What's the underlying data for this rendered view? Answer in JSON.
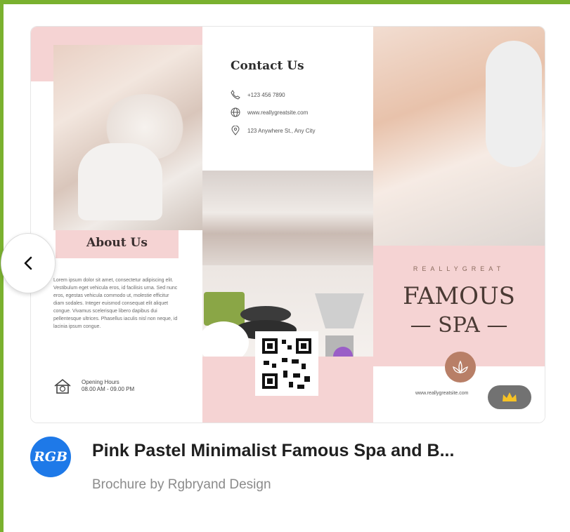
{
  "template": {
    "title": "Pink Pastel Minimalist Famous Spa and B...",
    "subtitle": "Brochure by Rgbryand Design",
    "author_avatar_text": "RGB",
    "premium_icon": "crown-icon"
  },
  "brochure": {
    "about_title": "About Us",
    "about_body": "Lorem ipsum dolor sit amet, consectetur adipiscing elit. Vestibulum eget vehicula eros, id facilisis urna. Sed nunc eros, egestas vehicula commodo ut, molestie efficitur diam sodales. Integer euismod consequat elit aliquet congue. Vivamus scelerisque libero dapibus dui pellentesque ultrices. Phasellus iaculis nisl non neque, id lacinia ipsum congue.",
    "hours_label": "Opening Hours",
    "hours_value": "08.00 AM - 09.00 PM",
    "contact_title": "Contact Us",
    "phone": "+123 456 7890",
    "website": "www.reallygreatsite.com",
    "address": "123 Anywhere St., Any City",
    "brand_small": "REALLYGREAT",
    "brand_big": "FAMOUS",
    "brand_spa": "SPA",
    "footer_site": "www.reallygreatsite.com"
  },
  "colors": {
    "frame": "#7ab12f",
    "pink": "#f5d3d3",
    "avatar": "#1e79e8"
  },
  "nav": {
    "prev_icon": "chevron-left-icon"
  }
}
